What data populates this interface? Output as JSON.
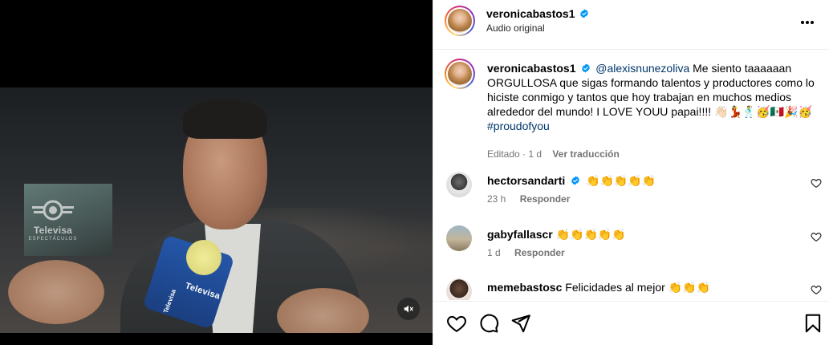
{
  "video": {
    "channel_logo": {
      "name": "Televisa",
      "sub": "ESPECTÁCULOS"
    },
    "mic_labels": {
      "front": "Televisa",
      "side": "Televisa"
    },
    "mute_icon": "speaker-muted-icon"
  },
  "post_header": {
    "username": "veronicabastos1",
    "verified": true,
    "audio_label": "Audio original",
    "more_icon": "more-horizontal-icon"
  },
  "caption": {
    "username": "veronicabastos1",
    "mention": "@alexisnunezoliva",
    "text": "Me siento taaaaaan ORGULLOSA que sigas formando talentos y productores como lo hiciste conmigo y tantos que hoy trabajan en muchos medios alrededor del mundo! I LOVE YOUU papai!!!! 👋🏻💃🕺🥳🇲🇽🎉🥳",
    "hashtag": "#proudofyou",
    "edited_label": "Editado",
    "time": "1 d",
    "see_translation": "Ver traducción"
  },
  "comments": [
    {
      "username": "hectorsandarti",
      "verified": true,
      "text": "👏👏👏👏👏",
      "time": "23 h",
      "reply_label": "Responder"
    },
    {
      "username": "gabyfallascr",
      "verified": false,
      "text": "👏👏👏👏👏",
      "time": "1 d",
      "reply_label": "Responder"
    },
    {
      "username": "memebastosc",
      "verified": false,
      "text": "Felicidades al mejor 👏👏👏",
      "time": "",
      "reply_label": ""
    }
  ],
  "actions": {
    "like_icon": "heart-icon",
    "comment_icon": "comment-icon",
    "share_icon": "send-icon",
    "save_icon": "bookmark-icon"
  },
  "colors": {
    "link": "#00376b",
    "verified": "#0095f6",
    "meta_text": "#737373",
    "divider": "#efefef"
  }
}
